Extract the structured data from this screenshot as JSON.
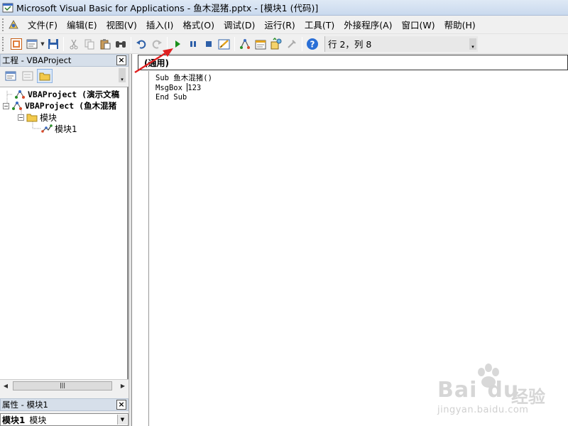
{
  "window": {
    "title": "Microsoft Visual Basic for Applications - 鱼木混猪.pptx - [模块1 (代码)]"
  },
  "menu": {
    "items": [
      {
        "label": "文件(F)"
      },
      {
        "label": "编辑(E)"
      },
      {
        "label": "视图(V)"
      },
      {
        "label": "插入(I)"
      },
      {
        "label": "格式(O)"
      },
      {
        "label": "调试(D)"
      },
      {
        "label": "运行(R)"
      },
      {
        "label": "工具(T)"
      },
      {
        "label": "外接程序(A)"
      },
      {
        "label": "窗口(W)"
      },
      {
        "label": "帮助(H)"
      }
    ]
  },
  "toolbar": {
    "position": "行 2，列 8",
    "icons": [
      "view-powerpoint-icon",
      "insert-module-icon",
      "save-icon",
      "cut-icon",
      "copy-icon",
      "paste-icon",
      "find-icon",
      "undo-icon",
      "redo-icon",
      "run-icon",
      "break-icon",
      "reset-icon",
      "design-mode-icon",
      "project-explorer-icon",
      "properties-icon",
      "object-browser-icon",
      "toolbox-icon",
      "help-icon"
    ]
  },
  "project_pane": {
    "title": "工程 - VBAProject",
    "tree": [
      {
        "label": "VBAProject (演示文稿",
        "bold": true
      },
      {
        "label": "VBAProject (鱼木混猪",
        "bold": true
      },
      {
        "label": "模块",
        "bold": false
      },
      {
        "label": "模块1",
        "bold": false
      }
    ]
  },
  "properties_pane": {
    "title": "属性 - 模块1",
    "object_name": "模块1",
    "object_type": "模块"
  },
  "code_window": {
    "object_selector": "(通用)",
    "lines": [
      "Sub 鱼木混猪()",
      "MsgBox 123",
      "End Sub"
    ]
  },
  "watermark": {
    "brand": "Bai",
    "brand2": "du",
    "cn": "经验",
    "url": "jingyan.baidu.com"
  },
  "colors": {
    "annotation_arrow": "#e02020",
    "run_icon": "#1a8f1a",
    "help_icon": "#2a6fd6"
  }
}
